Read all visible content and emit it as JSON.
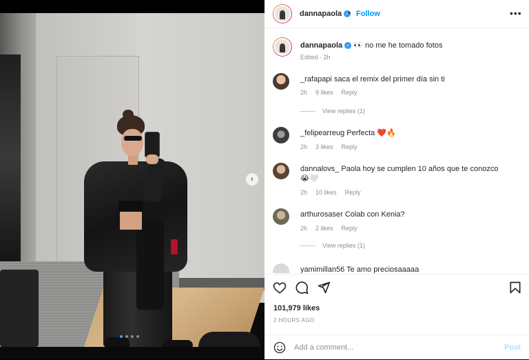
{
  "post": {
    "username": "dannapaola",
    "follow_label": "Follow",
    "separator": "•",
    "more_label": "•••",
    "caption_text": "no me he tomado fotos",
    "caption_emoji": "👀",
    "caption_meta": "Edited · 2h",
    "likes": "101,979 likes",
    "time": "2 HOURS AGO",
    "carousel_count": 4,
    "carousel_active": 1
  },
  "comments": [
    {
      "username": "_rafapapi",
      "text": "saca el remix del primer día sin ti",
      "time": "2h",
      "likes": "9 likes",
      "reply": "Reply",
      "view_replies": "View replies (1)"
    },
    {
      "username": "_felipearreug",
      "text": "Perfecta ❤️🔥",
      "time": "2h",
      "likes": "3 likes",
      "reply": "Reply"
    },
    {
      "username": "dannalovs_",
      "text": "Paola hoy se cumplen 10 años que te conozco 😭🤍",
      "time": "2h",
      "likes": "10 likes",
      "reply": "Reply"
    },
    {
      "username": "arthurosaser",
      "text": "Colab con Kenia?",
      "time": "2h",
      "likes": "2 likes",
      "reply": "Reply",
      "view_replies": "View replies (1)"
    },
    {
      "username": "yamimillan56",
      "text": "Te amo preciosaaaaa"
    }
  ],
  "composer": {
    "placeholder": "Add a comment...",
    "post_label": "Post"
  },
  "colors": {
    "accent": "#0095f6",
    "muted": "#8e8e8e",
    "post_disabled": "#b2dffc",
    "verified": "#3897f0"
  },
  "icons": {
    "like": "heart-icon",
    "comment": "comment-icon",
    "share": "paper-plane-icon",
    "save": "bookmark-icon",
    "emoji": "smiley-icon",
    "next": "chevron-right-icon"
  }
}
